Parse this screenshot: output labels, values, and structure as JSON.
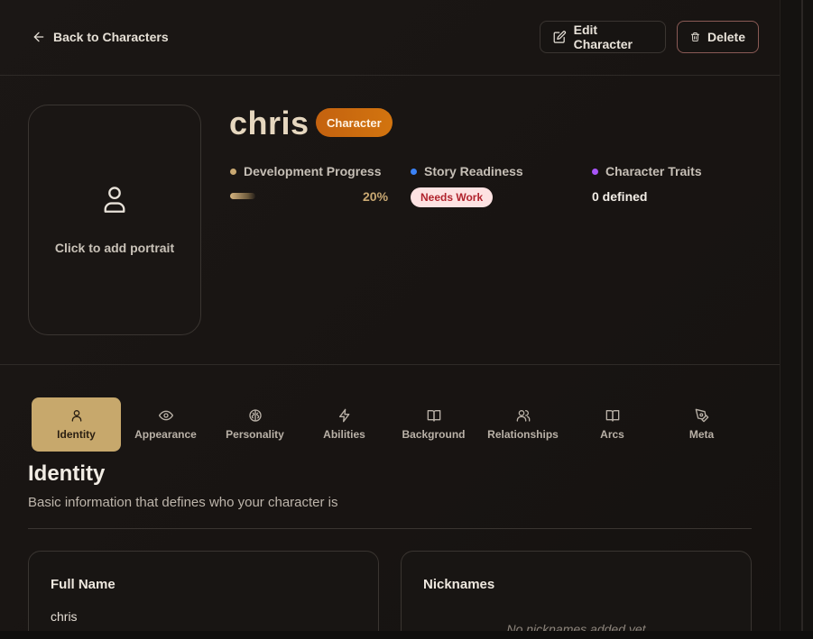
{
  "nav": {
    "back_label": "Back to Characters"
  },
  "actions": {
    "edit_label": "Edit Character",
    "delete_label": "Delete"
  },
  "portrait": {
    "placeholder_label": "Click to add portrait"
  },
  "character": {
    "name": "chris",
    "type_badge": "Character"
  },
  "stats": {
    "development": {
      "label": "Development Progress",
      "value": "20%",
      "fraction": 0.2,
      "dot_color": "#c9a872"
    },
    "readiness": {
      "label": "Story Readiness",
      "status": "Needs Work",
      "dot_color": "#3b82f6"
    },
    "traits": {
      "label": "Character Traits",
      "value": "0 defined",
      "dot_color": "#a855f7"
    }
  },
  "tabs": [
    {
      "label": "Identity",
      "icon": "user-icon",
      "active": true
    },
    {
      "label": "Appearance",
      "icon": "eye-icon",
      "active": false
    },
    {
      "label": "Personality",
      "icon": "brain-icon",
      "active": false
    },
    {
      "label": "Abilities",
      "icon": "lightning-icon",
      "active": false
    },
    {
      "label": "Background",
      "icon": "book-icon",
      "active": false
    },
    {
      "label": "Relationships",
      "icon": "users-icon",
      "active": false
    },
    {
      "label": "Arcs",
      "icon": "book-open-icon",
      "active": false
    },
    {
      "label": "Meta",
      "icon": "pen-tool-icon",
      "active": false
    }
  ],
  "section": {
    "title": "Identity",
    "description": "Basic information that defines who your character is"
  },
  "cards": {
    "full_name": {
      "title": "Full Name",
      "value": "chris"
    },
    "nicknames": {
      "title": "Nicknames",
      "empty_text": "No nicknames added yet"
    }
  },
  "colors": {
    "accent": "#c7a86c",
    "badge": "#c4620f",
    "needs_work_bg": "#fde2e2",
    "needs_work_text": "#b0232d"
  }
}
